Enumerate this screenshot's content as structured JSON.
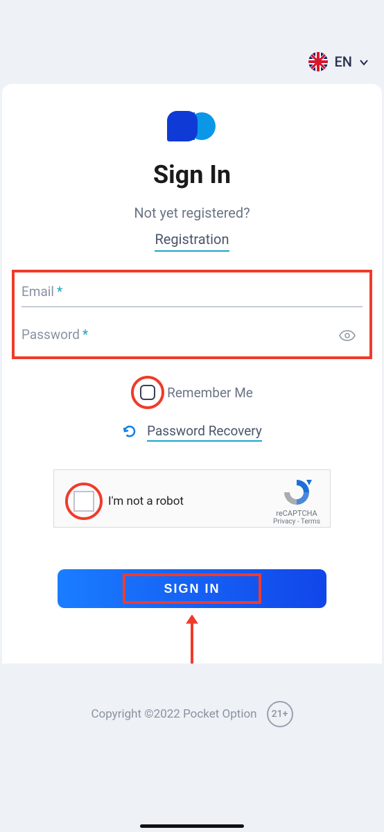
{
  "lang": {
    "label": "EN"
  },
  "header": {
    "title": "Sign In",
    "subtext": "Not yet registered?",
    "registration_link": "Registration"
  },
  "fields": {
    "email_label": "Email",
    "email_required": "*",
    "password_label": "Password",
    "password_required": "*"
  },
  "remember": {
    "label": "Remember Me"
  },
  "recovery": {
    "label": "Password Recovery"
  },
  "captcha": {
    "label": "I'm not a robot",
    "brand": "reCAPTCHA",
    "links": "Privacy - Terms"
  },
  "button": {
    "signin": "SIGN IN"
  },
  "footer": {
    "copyright": "Copyright ©2022 Pocket Option",
    "age": "21+"
  }
}
